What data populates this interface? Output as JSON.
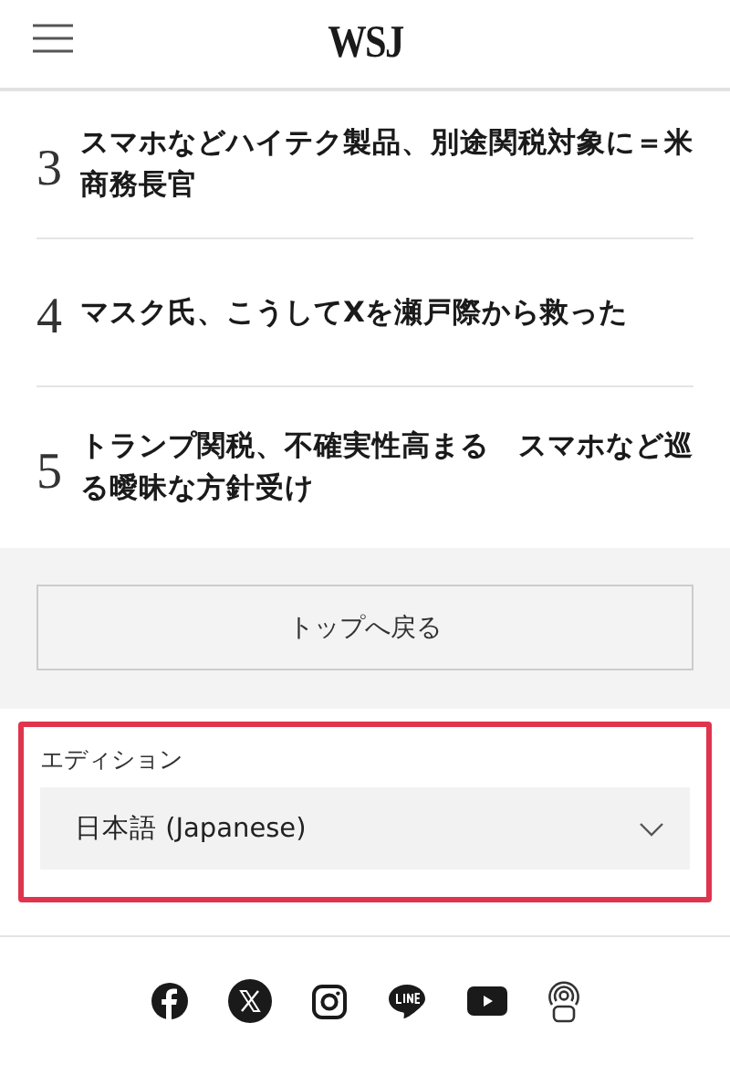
{
  "header": {
    "logo": "WSJ"
  },
  "articles": [
    {
      "rank": "3",
      "title": "スマホなどハイテク製品、別途関税対象に＝米商務長官"
    },
    {
      "rank": "4",
      "title": "マスク氏、こうしてXを瀬戸際から救った"
    },
    {
      "rank": "5",
      "title": "トランプ関税、不確実性高まる　スマホなど巡る曖昧な方針受け"
    }
  ],
  "back_to_top": "トップへ戻る",
  "edition": {
    "label": "エディション",
    "value": "日本語 (Japanese)",
    "highlighted": true
  },
  "social": [
    {
      "kind": "facebook"
    },
    {
      "kind": "x"
    },
    {
      "kind": "instagram"
    },
    {
      "kind": "line"
    },
    {
      "kind": "youtube"
    },
    {
      "kind": "podcast"
    }
  ]
}
